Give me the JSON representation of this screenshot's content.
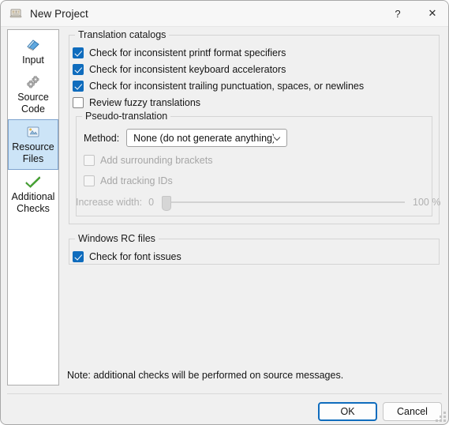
{
  "window": {
    "title": "New Project",
    "icon": "app-icon",
    "help_label": "?",
    "close_label": "✕"
  },
  "sidebar": {
    "items": [
      {
        "label_line1": "Input",
        "label_line2": "",
        "icon": "book-icon",
        "selected": false
      },
      {
        "label_line1": "Source",
        "label_line2": "Code",
        "icon": "gears-icon",
        "selected": false
      },
      {
        "label_line1": "Resource",
        "label_line2": "Files",
        "icon": "resource-files-icon",
        "selected": true
      },
      {
        "label_line1": "Additional",
        "label_line2": "Checks",
        "icon": "green-check-icon",
        "selected": false
      }
    ]
  },
  "groups": {
    "translation_catalogs": {
      "title": "Translation catalogs",
      "checkboxes": [
        {
          "label": "Check for inconsistent printf format specifiers",
          "checked": true,
          "disabled": false
        },
        {
          "label": "Check for inconsistent keyboard accelerators",
          "checked": true,
          "disabled": false
        },
        {
          "label": "Check for inconsistent trailing punctuation, spaces, or newlines",
          "checked": true,
          "disabled": false
        },
        {
          "label": "Review fuzzy translations",
          "checked": false,
          "disabled": false
        }
      ],
      "pseudo_translation": {
        "title": "Pseudo-translation",
        "method_label": "Method:",
        "method_value": "None (do not generate anything)",
        "method_options": [
          "None (do not generate anything)"
        ],
        "checkboxes": [
          {
            "label": "Add surrounding brackets",
            "checked": false,
            "disabled": true
          },
          {
            "label": "Add tracking IDs",
            "checked": false,
            "disabled": true
          }
        ],
        "slider": {
          "label": "Increase width:",
          "min_label": "0",
          "max_label": "100 %",
          "value": 0,
          "min": 0,
          "max": 100,
          "disabled": true
        }
      }
    },
    "windows_rc_files": {
      "title": "Windows RC files",
      "checkboxes": [
        {
          "label": "Check for font issues",
          "checked": true,
          "disabled": false
        }
      ]
    }
  },
  "note": "Note: additional checks will be performed on source messages.",
  "footer": {
    "ok_label": "OK",
    "cancel_label": "Cancel"
  },
  "colors": {
    "accent": "#0f6cbd",
    "selection_bg": "#cce4f7",
    "dialog_bg": "#f0f0f0",
    "titlebar_bg": "#f7f7f7",
    "disabled_text": "#a6a6a6",
    "green_check": "#3aaa35"
  }
}
